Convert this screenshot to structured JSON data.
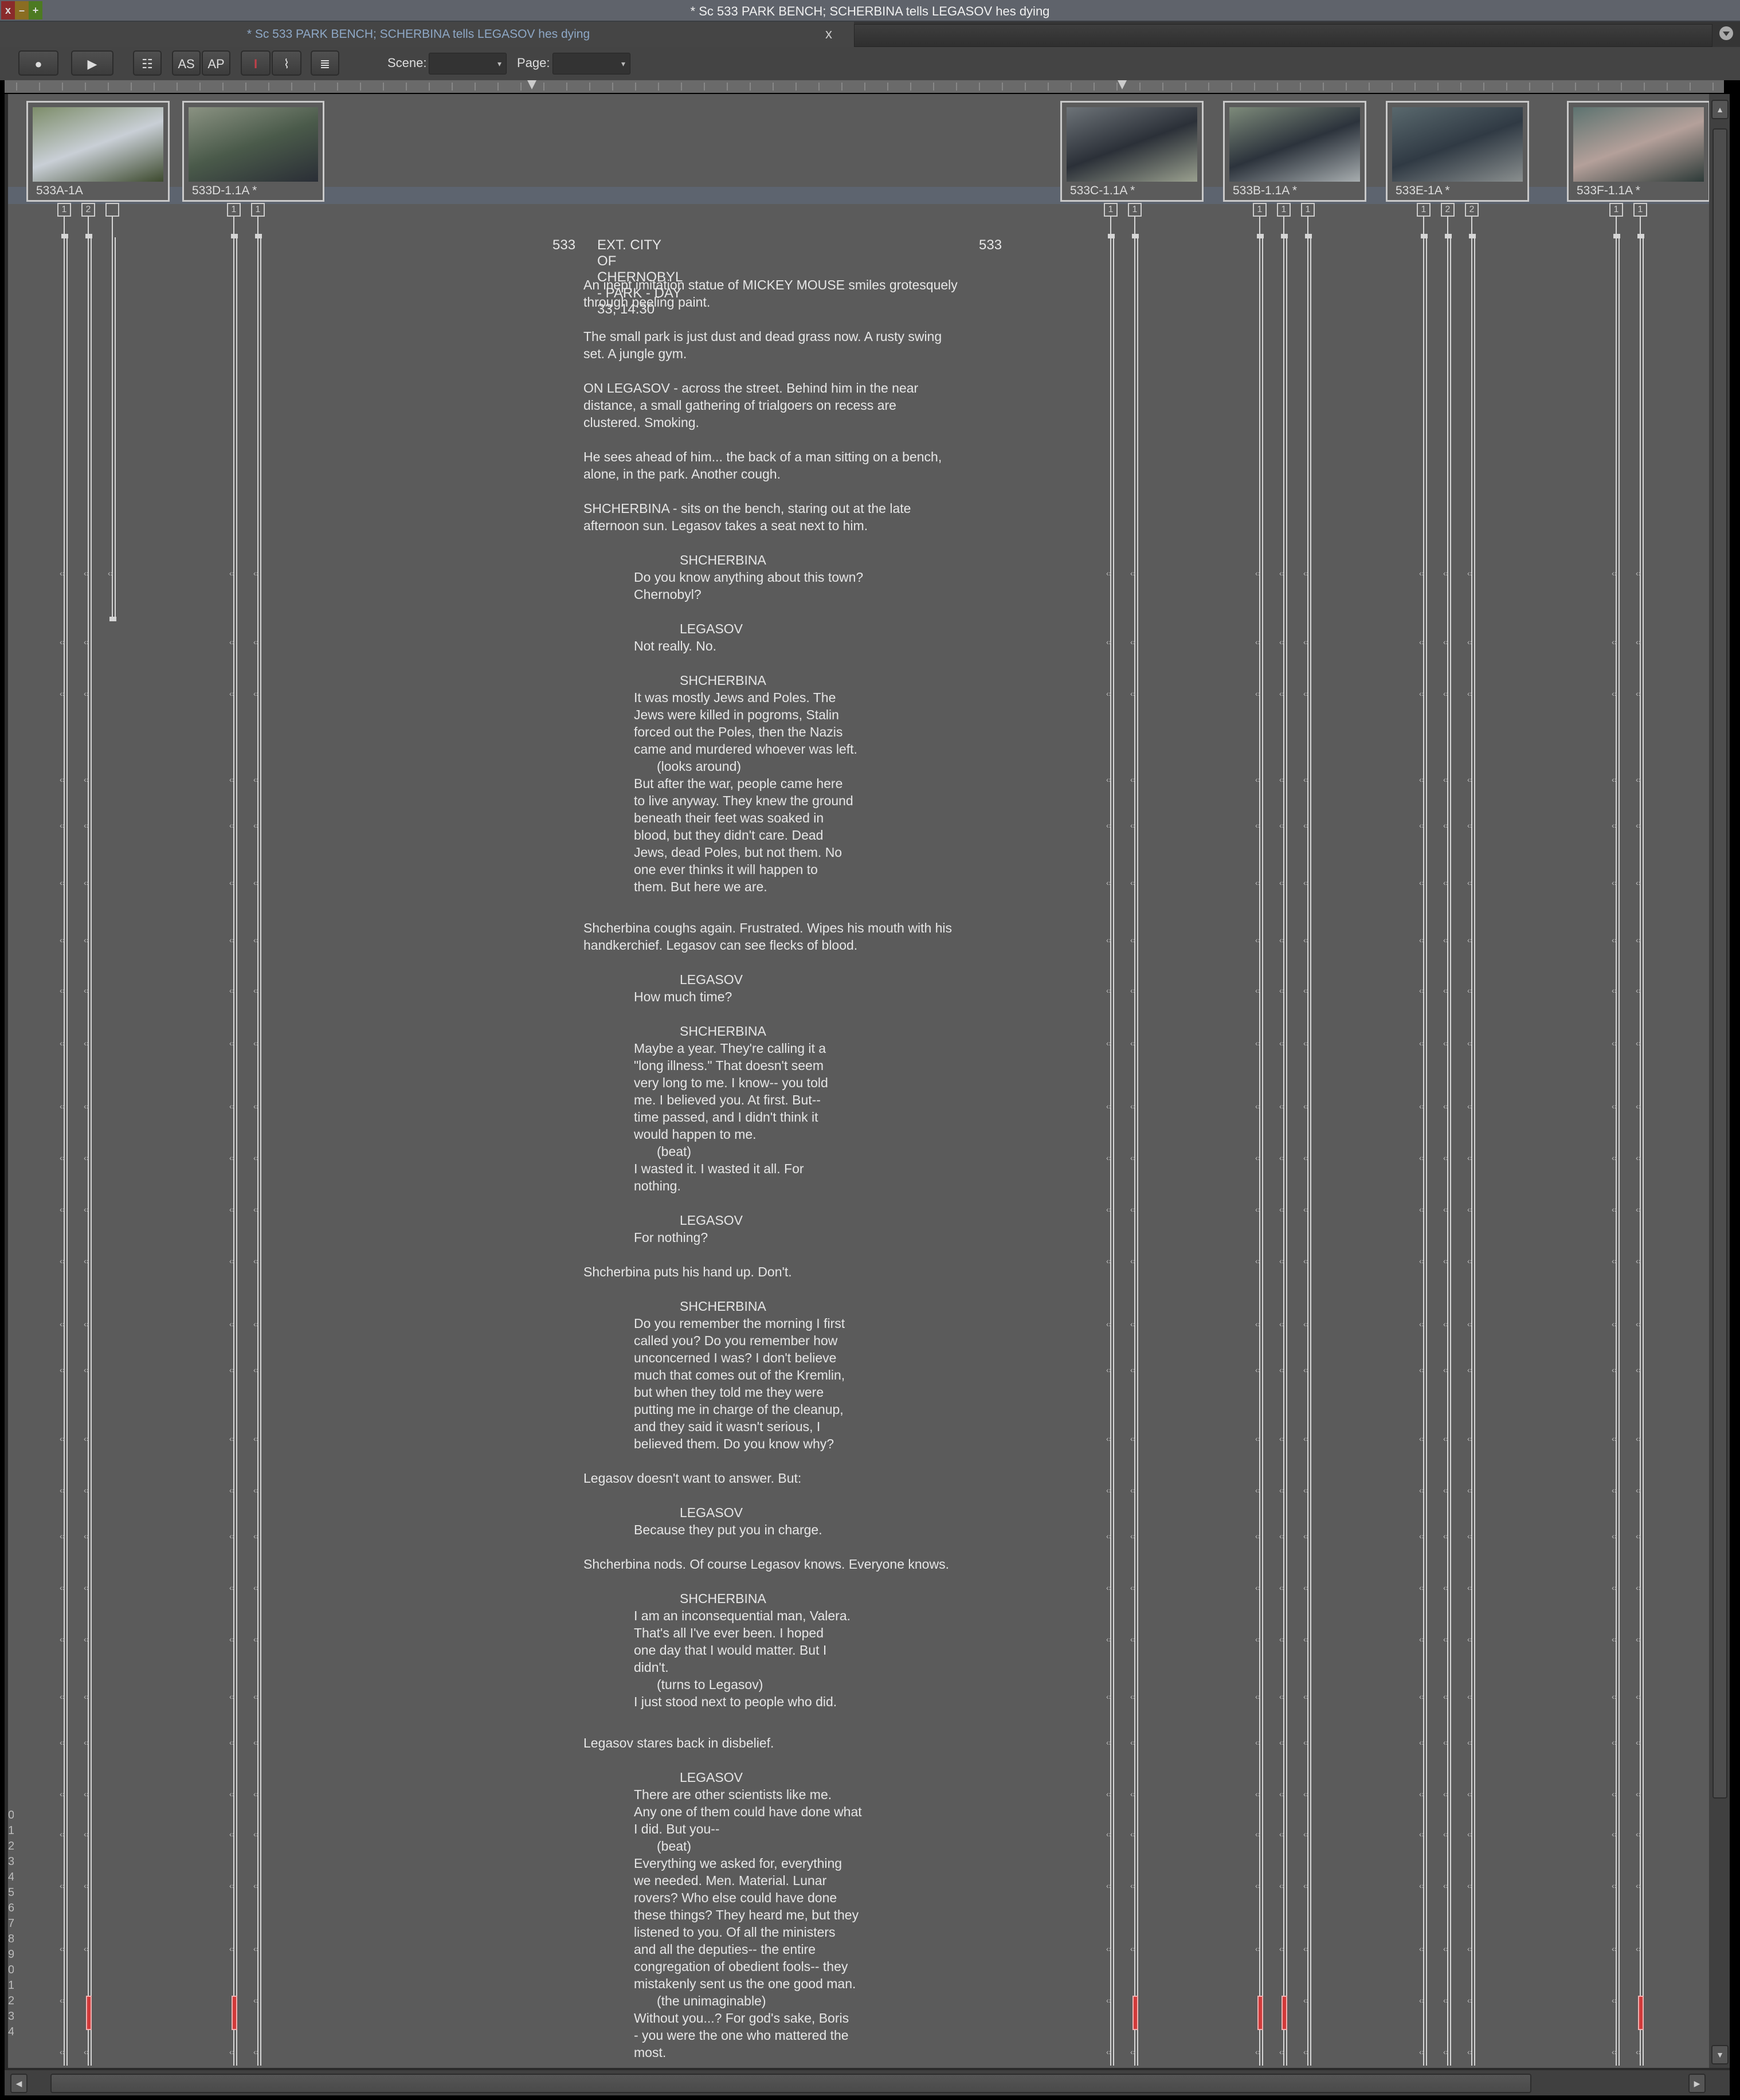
{
  "window": {
    "title": "* Sc 533 PARK BENCH; SCHERBINA tells LEGASOV hes dying",
    "close": "x",
    "minimize": "–",
    "maximize": "+"
  },
  "tab": {
    "title": "* Sc 533 PARK BENCH; SCHERBINA tells LEGASOV hes dying",
    "close": "x",
    "menu_icon": "⌄"
  },
  "toolbar": {
    "record_icon": "●",
    "play_icon": "▶",
    "script_view_icon": "☷",
    "as_label": "AS",
    "ap_label": "AP",
    "cursor_icon": "I",
    "squiggle_cursor_icon": "⌇",
    "page_view_icon": "≣",
    "scene_label": "Scene:",
    "scene_value": "",
    "page_label": "Page:",
    "page_value": "",
    "dropdown_arrow": "▾"
  },
  "shots": [
    {
      "label": "533A-1A",
      "takes": [
        "1",
        "2",
        ""
      ],
      "thumb_colors": [
        "#7d8d6a",
        "#c9cfd6",
        "#3d4a2e"
      ]
    },
    {
      "label": "533D-1.1A *",
      "takes": [
        "1",
        "1"
      ],
      "thumb_colors": [
        "#8a9282",
        "#4a5a4a",
        "#2a2e36"
      ]
    },
    {
      "label": "533C-1.1A *",
      "takes": [
        "1",
        "1"
      ],
      "thumb_colors": [
        "#6d7378",
        "#2b3038",
        "#9aa08f"
      ]
    },
    {
      "label": "533B-1.1A *",
      "takes": [
        "1",
        "1",
        "1"
      ],
      "thumb_colors": [
        "#7d8a7a",
        "#2c333c",
        "#a7adaf"
      ]
    },
    {
      "label": "533E-1A *",
      "takes": [
        "1",
        "2",
        "2"
      ],
      "thumb_colors": [
        "#59686d",
        "#303a44",
        "#8a8f8f"
      ]
    },
    {
      "label": "533F-1.1A *",
      "takes": [
        "1",
        "1"
      ],
      "thumb_colors": [
        "#5d7370",
        "#b4a09a",
        "#2d3a38"
      ]
    }
  ],
  "scene": {
    "number_left": "533",
    "heading": "EXT. CITY OF CHERNOBYL - PARK - DAY 33, 14:30",
    "number_right": "533"
  },
  "script_lines": [
    {
      "type": "action",
      "text": "An inept imitation statue of MICKEY MOUSE smiles grotesquely"
    },
    {
      "type": "action",
      "text": "through peeling paint."
    },
    {
      "type": "blank",
      "text": ""
    },
    {
      "type": "action",
      "text": "The small park is just dust and dead grass now. A rusty swing"
    },
    {
      "type": "action",
      "text": "set. A jungle gym."
    },
    {
      "type": "blank",
      "text": ""
    },
    {
      "type": "action",
      "text": "ON LEGASOV - across the street. Behind him in the near"
    },
    {
      "type": "action",
      "text": "distance, a small gathering of trialgoers on recess are"
    },
    {
      "type": "action",
      "text": "clustered. Smoking."
    },
    {
      "type": "blank",
      "text": ""
    },
    {
      "type": "action",
      "text": "He sees ahead of him... the back of a man sitting on a bench,"
    },
    {
      "type": "action",
      "text": "alone, in the park. Another cough."
    },
    {
      "type": "blank",
      "text": ""
    },
    {
      "type": "action",
      "text": "SHCHERBINA - sits on the bench, staring out at the late"
    },
    {
      "type": "action",
      "text": "afternoon sun. Legasov takes a seat next to him."
    },
    {
      "type": "blank",
      "text": ""
    },
    {
      "type": "character",
      "text": "SHCHERBINA"
    },
    {
      "type": "dialogue",
      "text": "Do you know anything about this town?"
    },
    {
      "type": "dialogue",
      "text": "Chernobyl?"
    },
    {
      "type": "blank",
      "text": ""
    },
    {
      "type": "character",
      "text": "LEGASOV"
    },
    {
      "type": "dialogue",
      "text": "Not really. No."
    },
    {
      "type": "blank",
      "text": ""
    },
    {
      "type": "character",
      "text": "SHCHERBINA"
    },
    {
      "type": "dialogue",
      "text": "It was mostly Jews and Poles. The"
    },
    {
      "type": "dialogue",
      "text": "Jews were killed in pogroms, Stalin"
    },
    {
      "type": "dialogue",
      "text": "forced out the Poles, then the Nazis"
    },
    {
      "type": "dialogue",
      "text": "came and murdered whoever was left."
    },
    {
      "type": "paren",
      "text": "(looks around)"
    },
    {
      "type": "dialogue",
      "text": "But after the war, people came here"
    },
    {
      "type": "dialogue",
      "text": "to live anyway. They knew the ground"
    },
    {
      "type": "dialogue",
      "text": "beneath their feet was soaked in"
    },
    {
      "type": "dialogue",
      "text": "blood, but they didn't care. Dead"
    },
    {
      "type": "dialogue",
      "text": "Jews, dead Poles, but not them. No"
    },
    {
      "type": "dialogue",
      "text": "one ever thinks it will happen to"
    },
    {
      "type": "dialogue",
      "text": "them. But here we are."
    },
    {
      "type": "blank",
      "text": ""
    },
    {
      "type": "gap",
      "text": ""
    },
    {
      "type": "action",
      "text": "Shcherbina coughs again. Frustrated. Wipes his mouth with his"
    },
    {
      "type": "action",
      "text": "handkerchief. Legasov can see flecks of blood."
    },
    {
      "type": "blank",
      "text": ""
    },
    {
      "type": "character",
      "text": "LEGASOV"
    },
    {
      "type": "dialogue",
      "text": "How much time?"
    },
    {
      "type": "blank",
      "text": ""
    },
    {
      "type": "character",
      "text": "SHCHERBINA"
    },
    {
      "type": "dialogue",
      "text": "Maybe a year. They're calling it a"
    },
    {
      "type": "dialogue",
      "text": "\"long illness.\" That doesn't seem"
    },
    {
      "type": "dialogue",
      "text": "very long to me. I know-- you told"
    },
    {
      "type": "dialogue",
      "text": "me. I believed you. At first. But--"
    },
    {
      "type": "dialogue",
      "text": "time passed, and I didn't think it"
    },
    {
      "type": "dialogue",
      "text": "would happen to me."
    },
    {
      "type": "paren",
      "text": "(beat)"
    },
    {
      "type": "dialogue",
      "text": "I wasted it. I wasted it all. For"
    },
    {
      "type": "dialogue",
      "text": "nothing."
    },
    {
      "type": "blank",
      "text": ""
    },
    {
      "type": "character",
      "text": "LEGASOV"
    },
    {
      "type": "dialogue",
      "text": "For nothing?"
    },
    {
      "type": "blank",
      "text": ""
    },
    {
      "type": "action",
      "text": "Shcherbina puts his hand up. Don't."
    },
    {
      "type": "blank",
      "text": ""
    },
    {
      "type": "character",
      "text": "SHCHERBINA"
    },
    {
      "type": "dialogue",
      "text": "Do you remember the morning I first"
    },
    {
      "type": "dialogue",
      "text": "called you? Do you remember how"
    },
    {
      "type": "dialogue",
      "text": "unconcerned I was? I don't believe"
    },
    {
      "type": "dialogue",
      "text": "much that comes out of the Kremlin,"
    },
    {
      "type": "dialogue",
      "text": "but when they told me they were"
    },
    {
      "type": "dialogue",
      "text": "putting me in charge of the cleanup,"
    },
    {
      "type": "dialogue",
      "text": "and they said it wasn't serious, I"
    },
    {
      "type": "dialogue",
      "text": "believed them. Do you know why?"
    },
    {
      "type": "blank",
      "text": ""
    },
    {
      "type": "action",
      "text": "Legasov doesn't want to answer. But:"
    },
    {
      "type": "blank",
      "text": ""
    },
    {
      "type": "character",
      "text": "LEGASOV"
    },
    {
      "type": "dialogue",
      "text": "Because they put you in charge."
    },
    {
      "type": "blank",
      "text": ""
    },
    {
      "type": "action",
      "text": "Shcherbina nods. Of course Legasov knows. Everyone knows."
    },
    {
      "type": "blank",
      "text": ""
    },
    {
      "type": "character",
      "text": "SHCHERBINA"
    },
    {
      "type": "dialogue",
      "text": "I am an inconsequential man, Valera."
    },
    {
      "type": "dialogue",
      "text": "That's all I've ever been. I hoped"
    },
    {
      "type": "dialogue",
      "text": "one day that I would matter. But I"
    },
    {
      "type": "dialogue",
      "text": "didn't."
    },
    {
      "type": "paren",
      "text": "(turns to Legasov)"
    },
    {
      "type": "dialogue",
      "text": "I just stood next to people who did."
    },
    {
      "type": "blank",
      "text": ""
    },
    {
      "type": "gap",
      "text": ""
    },
    {
      "type": "action",
      "text": "Legasov stares back in disbelief."
    },
    {
      "type": "blank",
      "text": ""
    },
    {
      "type": "character",
      "text": "LEGASOV"
    },
    {
      "type": "dialogue",
      "text": "There are other scientists like me."
    },
    {
      "type": "dialogue",
      "text": "Any one of them could have done what"
    },
    {
      "type": "dialogue",
      "text": "I did. But you--"
    },
    {
      "type": "paren",
      "text": "(beat)"
    },
    {
      "type": "dialogue",
      "text": "Everything we asked for, everything"
    },
    {
      "type": "dialogue",
      "text": "we needed. Men. Material. Lunar"
    },
    {
      "type": "dialogue",
      "text": "rovers? Who else could have done"
    },
    {
      "type": "dialogue",
      "text": "these things? They heard me, but they"
    },
    {
      "type": "dialogue",
      "text": "listened to you. Of all the ministers"
    },
    {
      "type": "dialogue",
      "text": "and all the deputies-- the entire"
    },
    {
      "type": "dialogue",
      "text": "congregation of obedient fools-- they"
    },
    {
      "type": "dialogue",
      "text": "mistakenly sent us the one good man."
    },
    {
      "type": "paren",
      "text": "(the unimaginable)"
    },
    {
      "type": "dialogue",
      "text": "Without you...? For god's sake, Boris"
    },
    {
      "type": "dialogue",
      "text": "- you were the one who mattered the"
    },
    {
      "type": "dialogue",
      "text": "most."
    }
  ],
  "line_numbers_partial": [
    "0",
    "1",
    "2",
    "3",
    "4",
    "5",
    "6",
    "7",
    "8",
    "9",
    "0",
    "1",
    "2",
    "3",
    "4"
  ],
  "colors": {
    "panel_bg": "#5b5b5b",
    "text": "#e6e6e6",
    "tab_title": "#8ea8c6",
    "take_line": "#d6d6d6",
    "circled_marker": "#d23a3a",
    "highlight_band": "#5e6b80"
  },
  "scroll": {
    "up_icon": "▲",
    "down_icon": "▼",
    "left_icon": "◀",
    "right_icon": "▶"
  }
}
